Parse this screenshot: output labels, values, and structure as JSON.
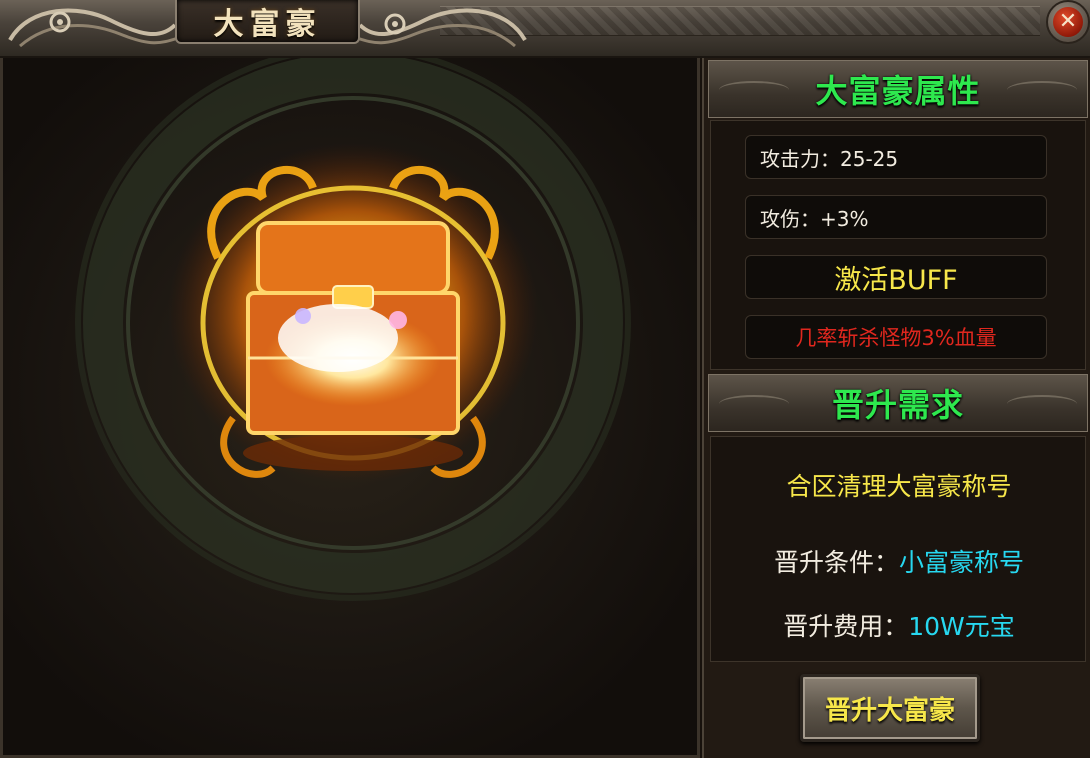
{
  "window": {
    "title": "大富豪",
    "close_icon": "close-icon"
  },
  "attributes": {
    "header": "大富豪属性",
    "attack": "攻击力：25-25",
    "attack_damage": "攻伤：+3%",
    "buff_label": "激活BUFF",
    "buff_description": "几率斩杀怪物3%血量"
  },
  "requirements": {
    "header": "晋升需求",
    "note": "合区清理大富豪称号",
    "condition_label": "晋升条件：",
    "condition_value": "小富豪称号",
    "cost_label": "晋升费用：",
    "cost_value": "10W元宝"
  },
  "actions": {
    "promote_label": "晋升大富豪"
  },
  "colors": {
    "header_green": "#2ee84e",
    "buff_yellow": "#f7e74a",
    "buff_red": "#e0271e",
    "value_cyan": "#27d8f0"
  }
}
